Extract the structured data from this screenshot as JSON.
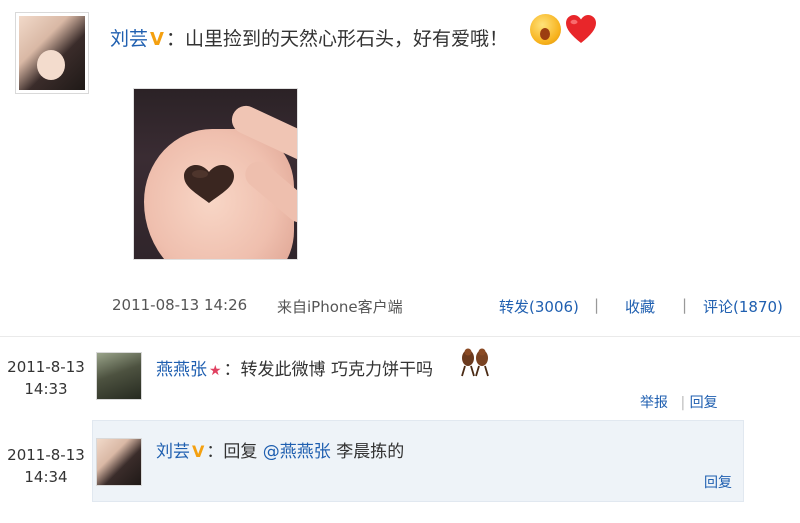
{
  "post": {
    "author": "刘芸",
    "text": "：山里捡到的天然心形石头，好有爱哦！",
    "time": "2011-08-13 14:26",
    "source": "来自iPhone客户端",
    "forward": "转发(3006)",
    "favorite": "收藏",
    "comment": "评论(1870)",
    "separator": "|",
    "emoji_wow": "surprised-face-emoji",
    "emoji_heart": "red-heart-emoji"
  },
  "comments": [
    {
      "date": "2011-8-13",
      "clock": "14:33",
      "author": "燕燕张",
      "text": "：转发此微博 巧克力饼干吗",
      "report": "举报",
      "reply": "回复"
    },
    {
      "date": "2011-8-13",
      "clock": "14:34",
      "author": "刘芸",
      "text": "：回复 ",
      "mention": "@燕燕张",
      "text_after": " 李晨拣的",
      "reply": "回复"
    }
  ],
  "colors": {
    "link": "#1f5fb0",
    "badge_v": "#f4a010",
    "reply_bg": "#eef3f8"
  }
}
